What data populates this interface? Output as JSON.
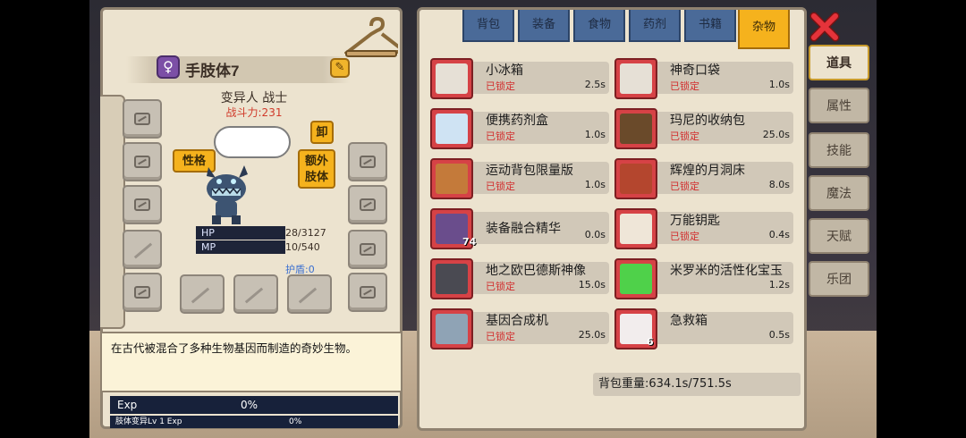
{
  "character": {
    "name": "手肢体7",
    "gender_icon": "♀",
    "class_line": "变异人 战士",
    "power": "战斗力:231",
    "trait_button": "性格",
    "unequip_button": "卸",
    "extra_limb_button": "额外\n肢体",
    "hp_label": "HP",
    "hp_value": "28/3127",
    "mp_label": "MP",
    "mp_value": "10/540",
    "shield": "护盾:0",
    "description": "在古代被混合了多种生物基因而制造的奇妙生物。",
    "exp_label": "Exp",
    "exp_pct": "0%",
    "limb_label": "肢体变异Lv 1 Exp",
    "limb_pct": "0%"
  },
  "inventory": {
    "tabs": [
      {
        "label": "背包"
      },
      {
        "label": "装备"
      },
      {
        "label": "食物"
      },
      {
        "label": "药剂"
      },
      {
        "label": "书籍"
      },
      {
        "label": "杂物"
      }
    ],
    "active_tab": "杂物",
    "items": [
      {
        "name": "小冰箱",
        "locked": "已锁定",
        "weight": "2.5s",
        "qty": ""
      },
      {
        "name": "神奇口袋",
        "locked": "已锁定",
        "weight": "1.0s",
        "qty": ""
      },
      {
        "name": "便携药剂盒",
        "locked": "已锁定",
        "weight": "1.0s",
        "qty": ""
      },
      {
        "name": "玛尼的收纳包",
        "locked": "已锁定",
        "weight": "25.0s",
        "qty": ""
      },
      {
        "name": "运动背包限量版",
        "locked": "已锁定",
        "weight": "1.0s",
        "qty": ""
      },
      {
        "name": "辉煌的月洞床",
        "locked": "已锁定",
        "weight": "8.0s",
        "qty": ""
      },
      {
        "name": "装备融合精华",
        "locked": "",
        "weight": "0.0s",
        "qty": "74"
      },
      {
        "name": "万能钥匙",
        "locked": "已锁定",
        "weight": "0.4s",
        "qty": ""
      },
      {
        "name": "地之欧巴德斯神像",
        "locked": "已锁定",
        "weight": "15.0s",
        "qty": ""
      },
      {
        "name": "米罗米的活性化宝玉",
        "locked": "",
        "weight": "1.2s",
        "qty": ""
      },
      {
        "name": "基因合成机",
        "locked": "已锁定",
        "weight": "25.0s",
        "qty": ""
      },
      {
        "name": "急救箱",
        "locked": "",
        "weight": "0.5s",
        "qty": "6"
      }
    ],
    "bag_weight": "背包重量:634.1s/751.5s"
  },
  "side_menu": {
    "items": [
      {
        "label": "道具"
      },
      {
        "label": "属性"
      },
      {
        "label": "技能"
      },
      {
        "label": "魔法"
      },
      {
        "label": "天赋"
      },
      {
        "label": "乐团"
      }
    ],
    "active": "道具"
  },
  "colors": {
    "panel_bg": "#ece3cf",
    "tab_blue": "#4a6a98",
    "tab_active": "#f5b21d",
    "locked_red": "#d22d2d",
    "item_frame_red": "#d64246"
  }
}
